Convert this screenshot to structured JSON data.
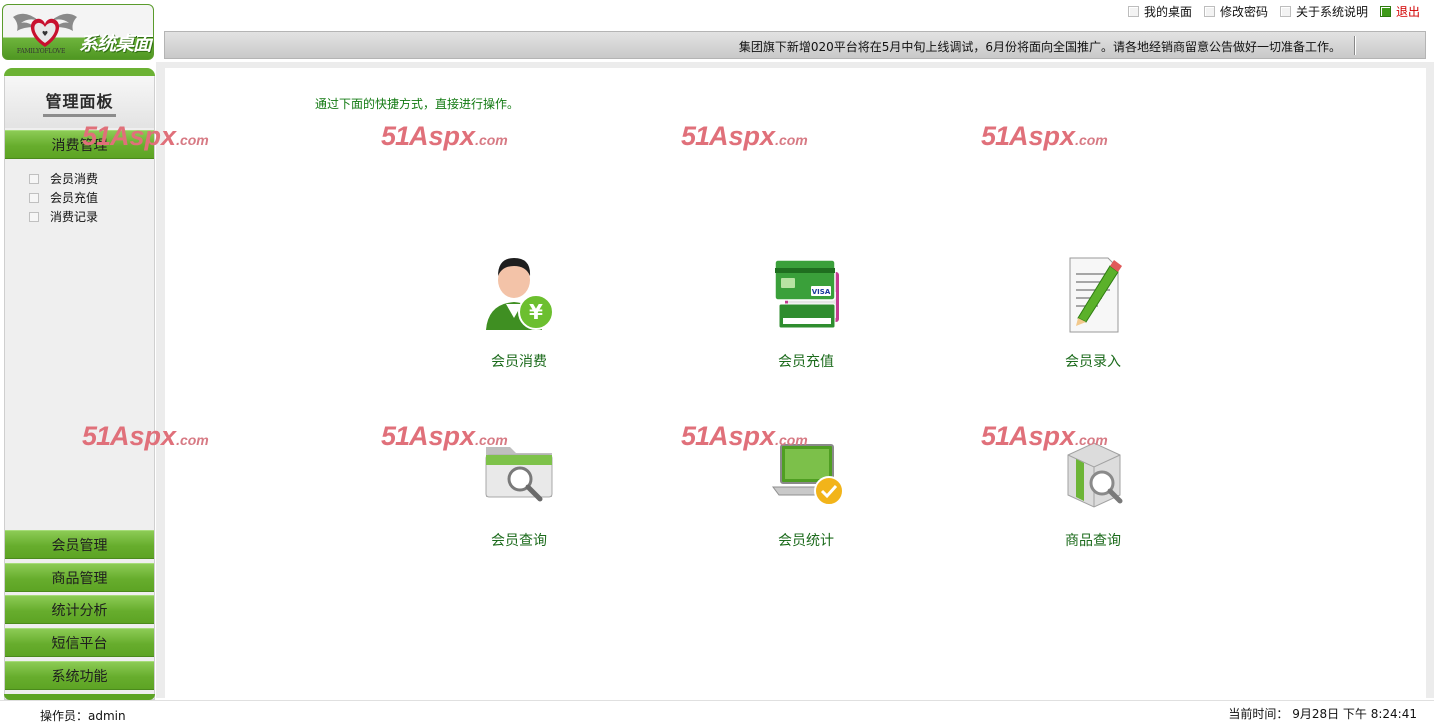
{
  "header": {
    "logo_small_text": "FAMILYOFLOVE",
    "logo_title": "系统桌面",
    "top_links": [
      "我的桌面",
      "修改密码",
      "关于系统说明"
    ],
    "exit_label": "退出",
    "notice": "集团旗下新增020平台将在5月中旬上线调试，6月份将面向全国推广。请各地经销商留意公告做好一切准备工作。"
  },
  "sidebar": {
    "panel_title": "管理面板",
    "active_menu": "消费管理",
    "submenu": [
      "会员消费",
      "会员充值",
      "消费记录"
    ],
    "menus": [
      "会员管理",
      "商品管理",
      "统计分析",
      "短信平台",
      "系统功能"
    ]
  },
  "main": {
    "hint": "通过下面的快捷方式，直接进行操作。",
    "shortcuts": [
      {
        "label": "会员消费",
        "icon": "member-consume-icon"
      },
      {
        "label": "会员充值",
        "icon": "recharge-card-icon"
      },
      {
        "label": "会员录入",
        "icon": "document-pencil-icon"
      },
      {
        "label": "会员查询",
        "icon": "folder-search-icon"
      },
      {
        "label": "会员统计",
        "icon": "laptop-check-icon"
      },
      {
        "label": "商品查询",
        "icon": "box-search-icon"
      }
    ]
  },
  "watermark": {
    "main": "51",
    "mid": "Aspx",
    "suffix": ".com"
  },
  "footer": {
    "operator": "操作员：admin",
    "clock": "当前时间： 9月28日 下午 8:24:41"
  }
}
